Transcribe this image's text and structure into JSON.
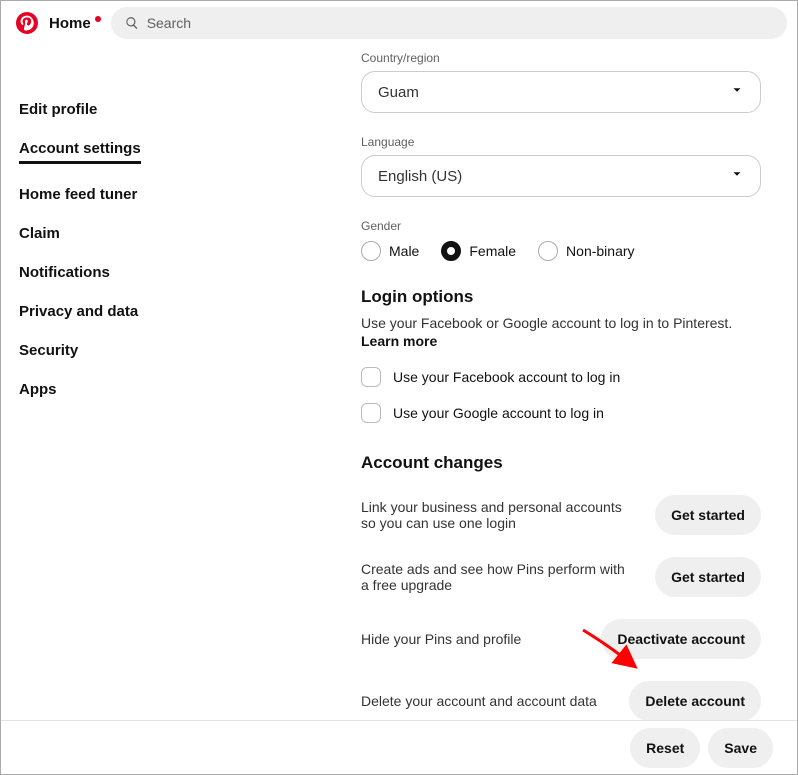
{
  "topbar": {
    "home": "Home",
    "search_placeholder": "Search"
  },
  "sidebar": {
    "items": [
      "Edit profile",
      "Account settings",
      "Home feed tuner",
      "Claim",
      "Notifications",
      "Privacy and data",
      "Security",
      "Apps"
    ],
    "active_index": 1
  },
  "main": {
    "country_label": "Country/region",
    "country_value": "Guam",
    "language_label": "Language",
    "language_value": "English (US)",
    "gender_label": "Gender",
    "gender_options": [
      "Male",
      "Female",
      "Non-binary"
    ],
    "gender_selected_index": 1,
    "login_title": "Login options",
    "login_desc": "Use your Facebook or Google account to log in to Pinterest.",
    "learn_more": "Learn more",
    "fb_checkbox": "Use your Facebook account to log in",
    "google_checkbox": "Use your Google account to log in",
    "changes_title": "Account changes",
    "actions": [
      {
        "desc": "Link your business and personal accounts so you can use one login",
        "btn": "Get started"
      },
      {
        "desc": "Create ads and see how Pins perform with a free upgrade",
        "btn": "Get started"
      },
      {
        "desc": "Hide your Pins and profile",
        "btn": "Deactivate account"
      },
      {
        "desc": "Delete your account and account data",
        "btn": "Delete account"
      }
    ]
  },
  "footer": {
    "reset": "Reset",
    "save": "Save"
  }
}
